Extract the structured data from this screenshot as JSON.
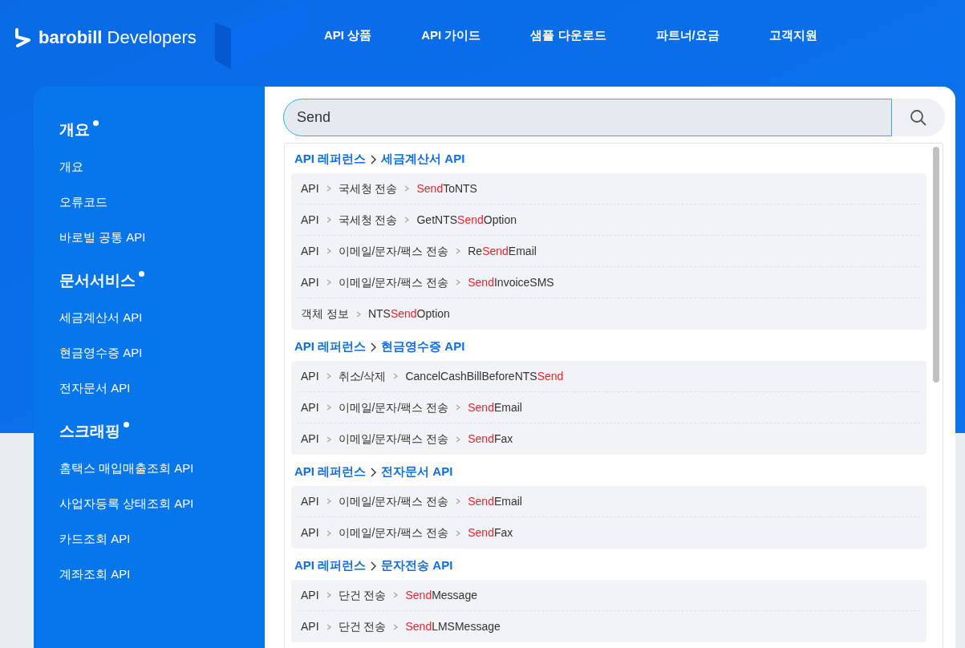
{
  "header": {
    "logo_brand": "barobill",
    "logo_suffix": "Developers",
    "nav": [
      {
        "label": "API 상품"
      },
      {
        "label": "API 가이드"
      },
      {
        "label": "샘플 다운로드"
      },
      {
        "label": "파트너/요금"
      },
      {
        "label": "고객지원"
      }
    ]
  },
  "sidebar": {
    "sections": [
      {
        "title": "개요",
        "items": [
          "개요",
          "오류코드",
          "바로빌 공통 API"
        ]
      },
      {
        "title": "문서서비스",
        "items": [
          "세금계산서 API",
          "현금영수증 API",
          "전자문서 API"
        ]
      },
      {
        "title": "스크래핑",
        "items": [
          "홈택스 매입매출조회 API",
          "사업자등록 상태조회 API",
          "카드조회 API",
          "계좌조회 API"
        ]
      }
    ]
  },
  "search": {
    "value": "Send"
  },
  "results": [
    {
      "path": [
        "API 레퍼런스",
        "세금계산서 API"
      ],
      "items": [
        {
          "path": [
            "API",
            "국세청 전송"
          ],
          "match": "Send",
          "after": "ToNTS"
        },
        {
          "path": [
            "API",
            "국세청 전송"
          ],
          "before": "GetNTS",
          "match": "Send",
          "after": "Option"
        },
        {
          "path": [
            "API",
            "이메일/문자/팩스 전송"
          ],
          "before": "Re",
          "match": "Send",
          "after": "Email"
        },
        {
          "path": [
            "API",
            "이메일/문자/팩스 전송"
          ],
          "match": "Send",
          "after": "InvoiceSMS"
        },
        {
          "path": [
            "객체 정보"
          ],
          "before": "NTS",
          "match": "Send",
          "after": "Option"
        }
      ]
    },
    {
      "path": [
        "API 레퍼런스",
        "현금영수증 API"
      ],
      "items": [
        {
          "path": [
            "API",
            "취소/삭제"
          ],
          "before": "CancelCashBillBeforeNTS",
          "match": "Send"
        },
        {
          "path": [
            "API",
            "이메일/문자/팩스 전송"
          ],
          "match": "Send",
          "after": "Email"
        },
        {
          "path": [
            "API",
            "이메일/문자/팩스 전송"
          ],
          "match": "Send",
          "after": "Fax"
        }
      ]
    },
    {
      "path": [
        "API 레퍼런스",
        "전자문서 API"
      ],
      "items": [
        {
          "path": [
            "API",
            "이메일/문자/팩스 전송"
          ],
          "match": "Send",
          "after": "Email"
        },
        {
          "path": [
            "API",
            "이메일/문자/팩스 전송"
          ],
          "match": "Send",
          "after": "Fax"
        }
      ]
    },
    {
      "path": [
        "API 레퍼런스",
        "문자전송 API"
      ],
      "items": [
        {
          "path": [
            "API",
            "단건 전송"
          ],
          "match": "Send",
          "after": "Message"
        },
        {
          "path": [
            "API",
            "단건 전송"
          ],
          "match": "Send",
          "after": "LMSMessage"
        }
      ]
    }
  ]
}
